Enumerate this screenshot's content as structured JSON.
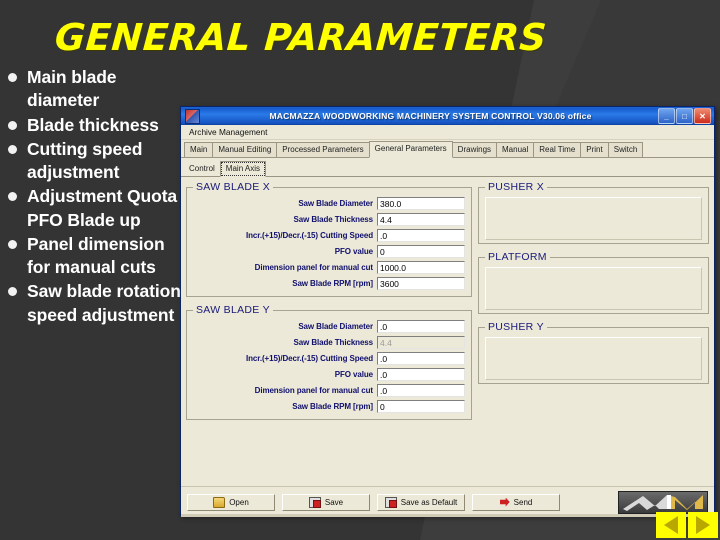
{
  "slide": {
    "title": "GENERAL PARAMETERS",
    "title_color": "#ffff00",
    "background_color": "#343434",
    "bullets": [
      "Main blade diameter",
      "Blade thickness",
      "Cutting speed adjustment",
      "Adjustment Quota PFO Blade up",
      "Panel dimension for manual cuts",
      "Saw blade rotation speed adjustment"
    ]
  },
  "app": {
    "titlebar": {
      "title": "MACMAZZA  WOODWORKING MACHINERY SYSTEM CONTROL  V30.06 office",
      "minimize": "_",
      "maximize": "□",
      "close": "✕"
    },
    "menu": [
      "Archive Management"
    ],
    "tabs": [
      {
        "label": "Main",
        "active": false
      },
      {
        "label": "Manual Editing",
        "active": false
      },
      {
        "label": "Processed Parameters",
        "active": false
      },
      {
        "label": "General Parameters",
        "active": true
      },
      {
        "label": "Drawings",
        "active": false
      },
      {
        "label": "Manual",
        "active": false
      },
      {
        "label": "Real Time",
        "active": false
      },
      {
        "label": "Print",
        "active": false
      },
      {
        "label": "Switch",
        "active": false
      }
    ],
    "subtabs": [
      {
        "label": "Control",
        "active": false
      },
      {
        "label": "Main Axis",
        "active": true
      }
    ],
    "groups": {
      "saw_blade_x": {
        "legend": "SAW BLADE X",
        "rows": [
          {
            "label": "Saw Blade Diameter",
            "value": "380.0",
            "dim": false
          },
          {
            "label": "Saw Blade  Thickness",
            "value": "4.4",
            "dim": false
          },
          {
            "label": "Incr.(+15)/Decr.(-15) Cutting Speed",
            "value": ".0",
            "dim": false
          },
          {
            "label": "PFO value",
            "value": "0",
            "dim": false
          },
          {
            "label": "Dimension panel for manual cut",
            "value": "1000.0",
            "dim": false
          },
          {
            "label": "Saw Blade RPM [rpm]",
            "value": "3600",
            "dim": false
          }
        ]
      },
      "saw_blade_y": {
        "legend": "SAW BLADE Y",
        "rows": [
          {
            "label": "Saw Blade Diameter",
            "value": ".0",
            "dim": false
          },
          {
            "label": "Saw Blade  Thickness",
            "value": "4.4",
            "dim": true
          },
          {
            "label": "Incr.(+15)/Decr.(-15) Cutting Speed",
            "value": ".0",
            "dim": false
          },
          {
            "label": "PFO value",
            "value": ".0",
            "dim": false
          },
          {
            "label": "Dimension panel for manual cut",
            "value": ".0",
            "dim": false
          },
          {
            "label": "Saw Blade RPM [rpm]",
            "value": "0",
            "dim": false
          }
        ]
      },
      "pusher_x": {
        "legend": "PUSHER X"
      },
      "platform": {
        "legend": "PLATFORM"
      },
      "pusher_y": {
        "legend": "PUSHER Y"
      }
    },
    "buttons": [
      {
        "label": "Open",
        "icon": "folder-open-icon"
      },
      {
        "label": "Save",
        "icon": "floppy-disk-icon"
      },
      {
        "label": "Save as Default",
        "icon": "floppy-disk-icon"
      },
      {
        "label": "Send",
        "icon": "arrow-right-icon"
      }
    ],
    "logo_text": "MM"
  },
  "nav": {
    "previous": "◀",
    "next": "▶"
  }
}
